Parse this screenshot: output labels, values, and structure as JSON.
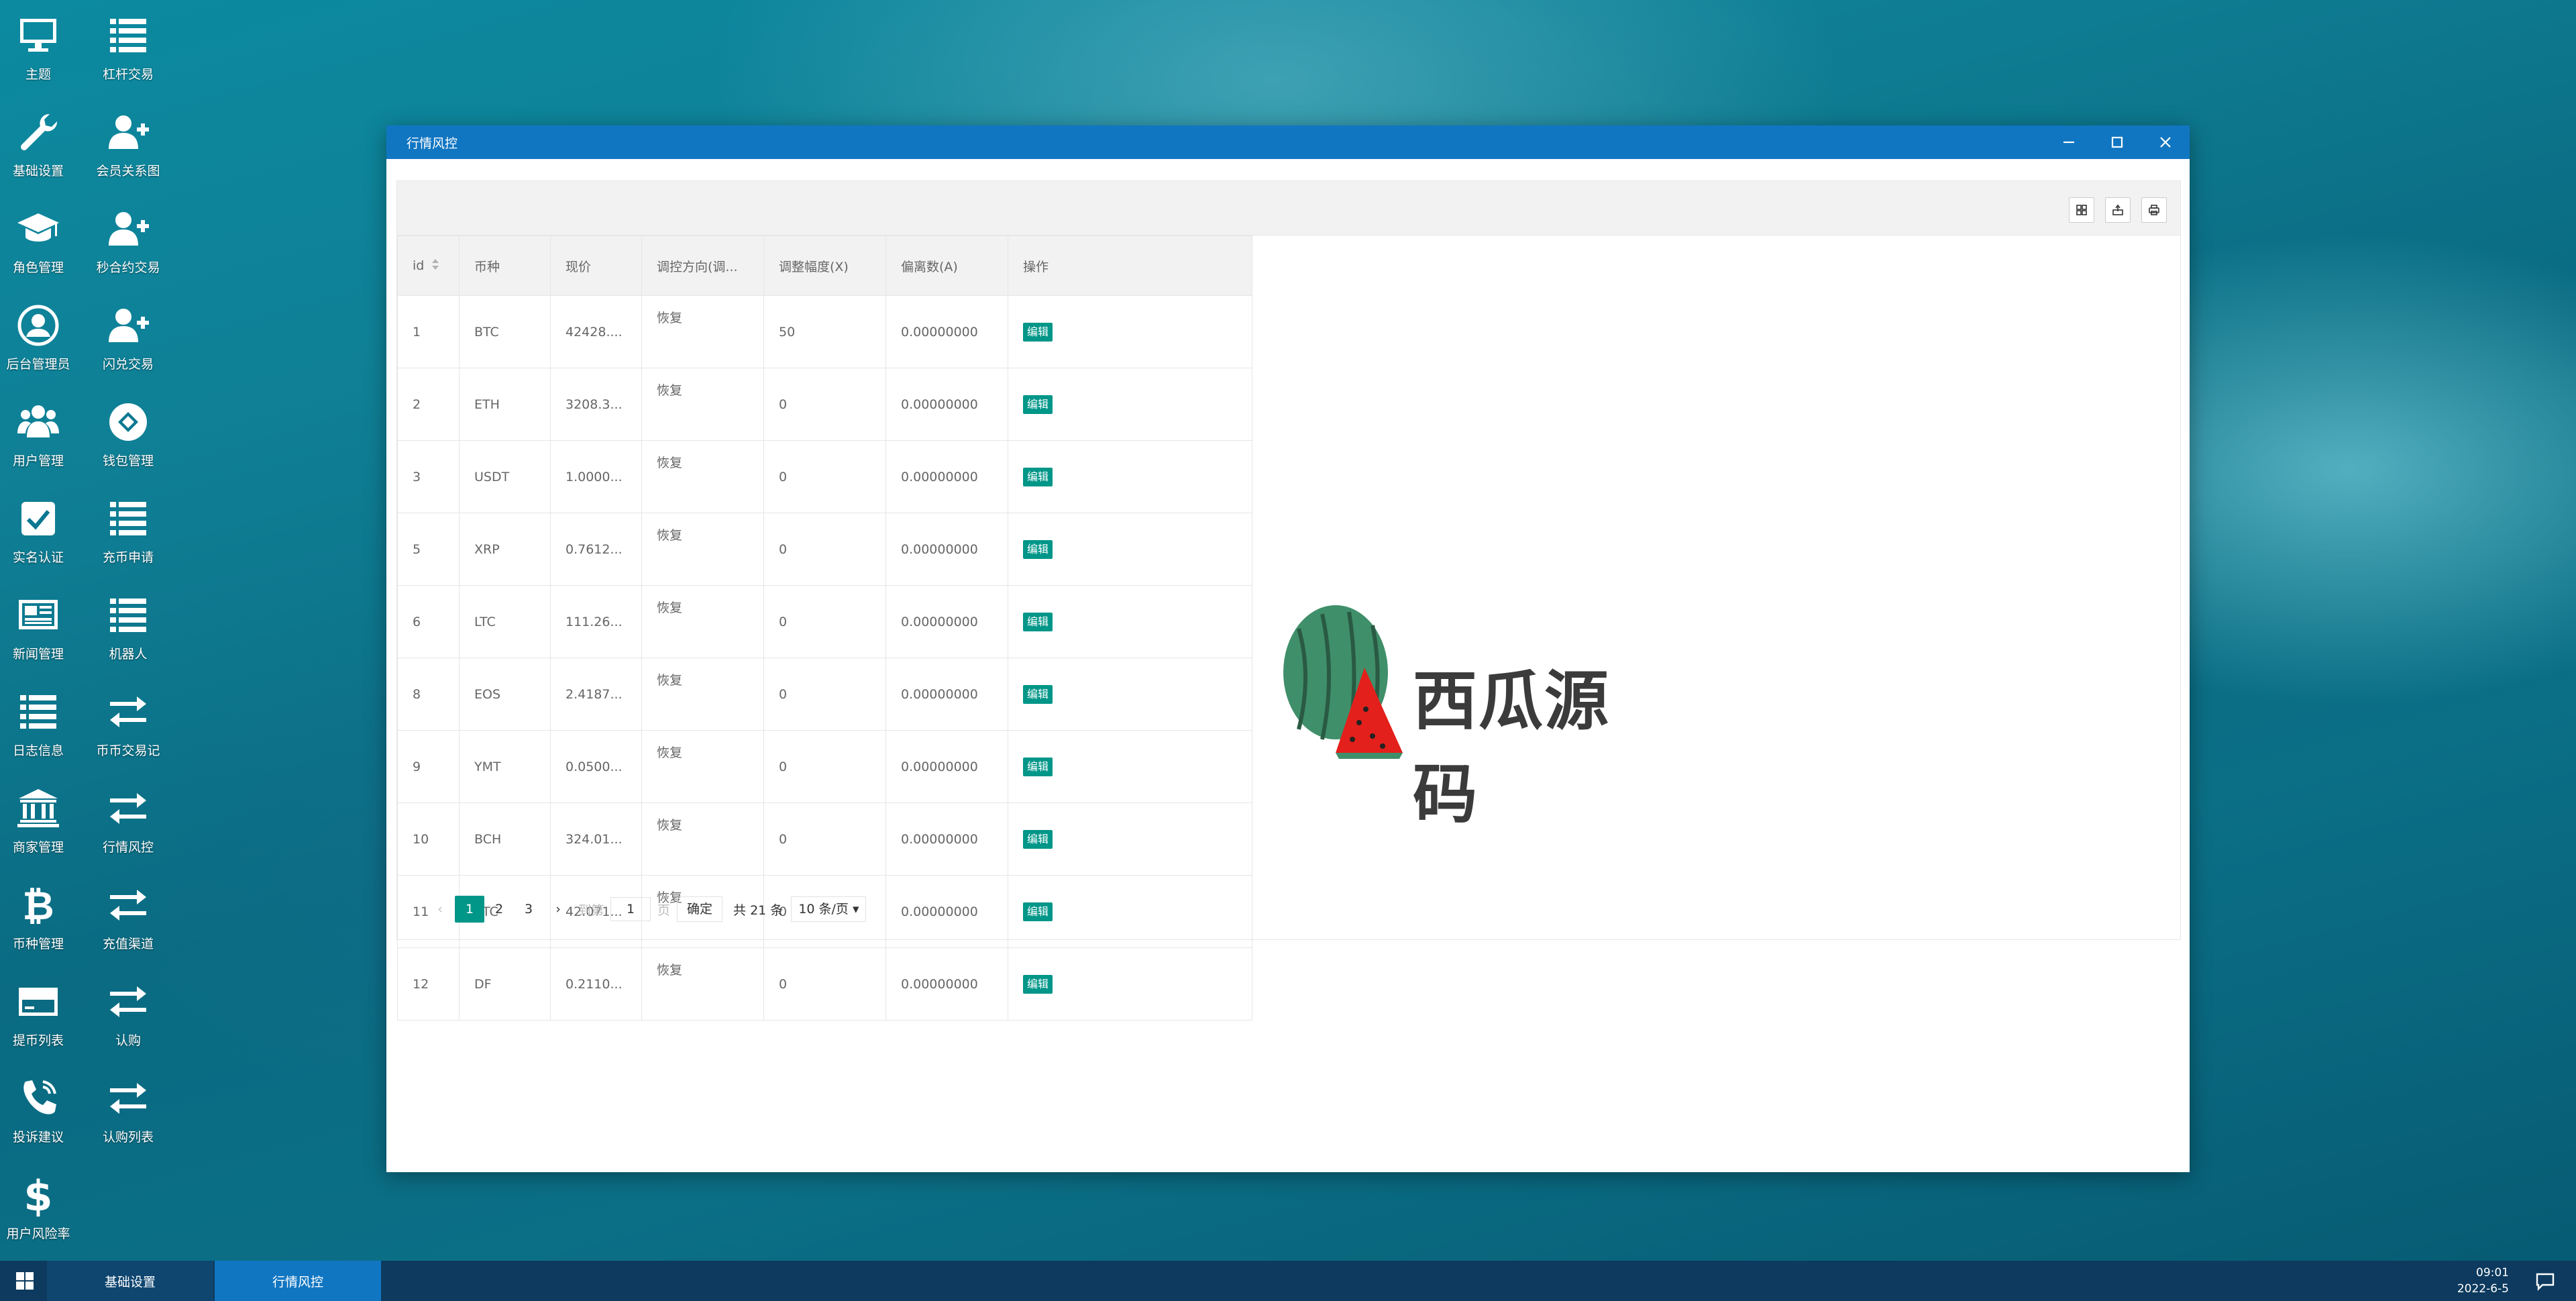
{
  "desktop": {
    "icons": [
      {
        "label": "主题",
        "icon": "monitor-icon"
      },
      {
        "label": "杠杆交易",
        "icon": "list-icon"
      },
      {
        "label": "基础设置",
        "icon": "wrench-icon"
      },
      {
        "label": "会员关系图",
        "icon": "user-plus-icon"
      },
      {
        "label": "角色管理",
        "icon": "graduation-cap-icon"
      },
      {
        "label": "秒合约交易",
        "icon": "user-plus-icon"
      },
      {
        "label": "后台管理员",
        "icon": "user-circle-icon"
      },
      {
        "label": "闪兑交易",
        "icon": "user-plus-icon"
      },
      {
        "label": "用户管理",
        "icon": "users-icon"
      },
      {
        "label": "钱包管理",
        "icon": "wallet-icon"
      },
      {
        "label": "实名认证",
        "icon": "check-square-icon"
      },
      {
        "label": "充币申请",
        "icon": "list-icon"
      },
      {
        "label": "新闻管理",
        "icon": "newspaper-icon"
      },
      {
        "label": "机器人",
        "icon": "list-icon"
      },
      {
        "label": "日志信息",
        "icon": "list-icon"
      },
      {
        "label": "币币交易记",
        "icon": "exchange-icon"
      },
      {
        "label": "商家管理",
        "icon": "bank-icon"
      },
      {
        "label": "行情风控",
        "icon": "exchange-icon"
      },
      {
        "label": "币种管理",
        "icon": "bitcoin-icon"
      },
      {
        "label": "充值渠道",
        "icon": "exchange-icon"
      },
      {
        "label": "提币列表",
        "icon": "credit-card-icon"
      },
      {
        "label": "认购",
        "icon": "exchange-icon"
      },
      {
        "label": "投诉建议",
        "icon": "phone-icon"
      },
      {
        "label": "认购列表",
        "icon": "exchange-icon"
      },
      {
        "label": "用户风险率",
        "icon": "dollar-icon"
      }
    ]
  },
  "window": {
    "title": "行情风控",
    "controls": [
      "minimize-icon",
      "maximize-icon",
      "close-icon"
    ]
  },
  "toolbar": {
    "buttons": [
      "columns-icon",
      "export-icon",
      "print-icon"
    ]
  },
  "table": {
    "headers": {
      "id": "id",
      "coin": "币种",
      "price": "现价",
      "direction": "调控方向(调...",
      "range": "调整幅度(X)",
      "offset": "偏离数(A)",
      "action": "操作"
    },
    "rows": [
      {
        "id": "1",
        "coin": "BTC",
        "price": "42428....",
        "direction": "恢复",
        "range": "50",
        "offset": "0.00000000",
        "action": "编辑"
      },
      {
        "id": "2",
        "coin": "ETH",
        "price": "3208.3...",
        "direction": "恢复",
        "range": "0",
        "offset": "0.00000000",
        "action": "编辑"
      },
      {
        "id": "3",
        "coin": "USDT",
        "price": "1.0000...",
        "direction": "恢复",
        "range": "0",
        "offset": "0.00000000",
        "action": "编辑"
      },
      {
        "id": "5",
        "coin": "XRP",
        "price": "0.7612...",
        "direction": "恢复",
        "range": "0",
        "offset": "0.00000000",
        "action": "编辑"
      },
      {
        "id": "6",
        "coin": "LTC",
        "price": "111.26...",
        "direction": "恢复",
        "range": "0",
        "offset": "0.00000000",
        "action": "编辑"
      },
      {
        "id": "8",
        "coin": "EOS",
        "price": "2.4187...",
        "direction": "恢复",
        "range": "0",
        "offset": "0.00000000",
        "action": "编辑"
      },
      {
        "id": "9",
        "coin": "YMT",
        "price": "0.0500...",
        "direction": "恢复",
        "range": "0",
        "offset": "0.00000000",
        "action": "编辑"
      },
      {
        "id": "10",
        "coin": "BCH",
        "price": "324.01...",
        "direction": "恢复",
        "range": "0",
        "offset": "0.00000000",
        "action": "编辑"
      },
      {
        "id": "11",
        "coin": "ETC",
        "price": "42.071...",
        "direction": "恢复",
        "range": "0",
        "offset": "0.00000000",
        "action": "编辑"
      },
      {
        "id": "12",
        "coin": "DF",
        "price": "0.2110...",
        "direction": "恢复",
        "range": "0",
        "offset": "0.00000000",
        "action": "编辑"
      }
    ]
  },
  "pagination": {
    "prev": "‹",
    "pages": [
      "1",
      "2",
      "3"
    ],
    "active_page": "1",
    "next": "›",
    "goto_label": "到第",
    "goto_value": "1",
    "page_unit": "页",
    "confirm": "确定",
    "total": "共 21 条",
    "page_size": "10 条/页"
  },
  "watermark": {
    "text": "西瓜源码"
  },
  "taskbar": {
    "start_icon": "windows-icon",
    "tabs": [
      "基础设置",
      "行情风控"
    ],
    "time": "09:01",
    "date": "2022-6-5",
    "notification_icon": "chat-bubble-icon"
  },
  "colors": {
    "title_bar": "#1176c2",
    "taskbar": "#0d3a5e",
    "accent": "#009688"
  }
}
